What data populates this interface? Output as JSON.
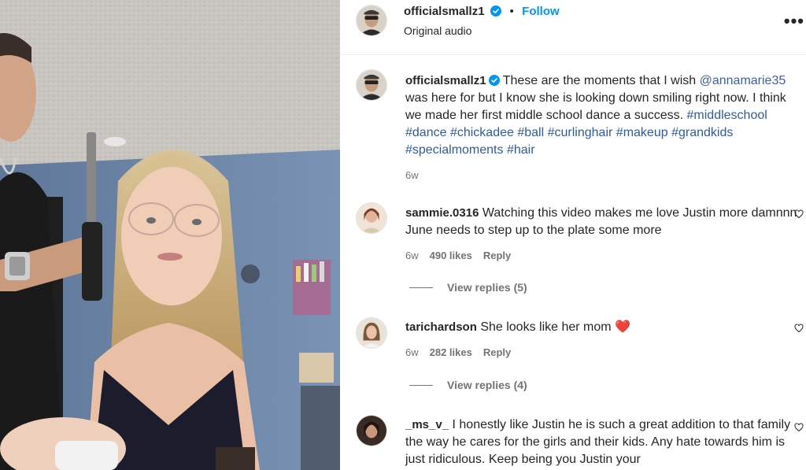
{
  "post": {
    "username": "officialsmallz1",
    "follow_label": "Follow",
    "audio": "Original audio",
    "caption": {
      "username": "officialsmallz1",
      "text_1": "These are the moments that I wish",
      "mention": "@annamarie35",
      "text_2": "was here for but I know she is looking down smiling right now. I think we made her first middle school dance a success.",
      "hashtags": [
        "#middleschool",
        "#dance",
        "#chickadee",
        "#ball",
        "#curlinghair",
        "#makeup",
        "#grandkids",
        "#specialmoments",
        "#hair"
      ],
      "time": "6w"
    }
  },
  "comments": [
    {
      "username": "sammie.0316",
      "text": "Watching this video makes me love Justin more damnnn June needs to step up to the plate some more",
      "time": "6w",
      "likes": "490 likes",
      "reply_label": "Reply",
      "view_replies": "View replies (5)"
    },
    {
      "username": "tarichardson",
      "text": "She looks like her mom",
      "emoji": "❤️",
      "time": "6w",
      "likes": "282 likes",
      "reply_label": "Reply",
      "view_replies": "View replies (4)"
    },
    {
      "username": "_ms_v_",
      "text": "I honestly like Justin he is such a great addition to that family the way he cares for the girls and their kids. Any hate towards him is just ridiculous. Keep being you Justin your"
    }
  ],
  "colors": {
    "follow": "#0095f6",
    "hashtag": "#2f5aa8",
    "verified": "#0095f6",
    "heart": "#ed4956"
  },
  "icons": {
    "verified": "verified-badge-icon",
    "more": "more-options-icon",
    "heart": "heart-icon"
  }
}
